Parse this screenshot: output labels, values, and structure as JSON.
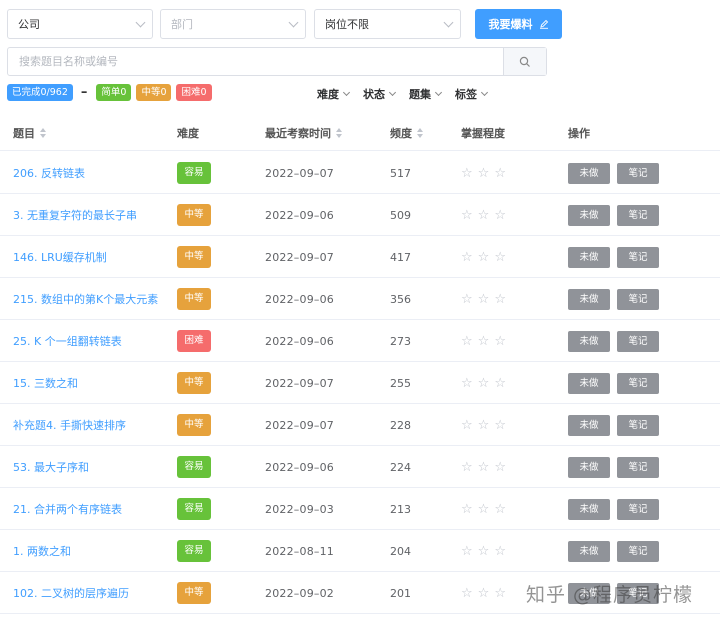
{
  "filters": {
    "company": "公司",
    "department": "部门",
    "position": "岗位不限",
    "submit_label": "我要爆料"
  },
  "search": {
    "placeholder": "搜索题目名称或编号"
  },
  "stats": {
    "completed": "已完成0/962",
    "easy": "简单0",
    "medium": "中等0",
    "hard": "困难0"
  },
  "dropdowns": [
    "难度",
    "状态",
    "题集",
    "标签"
  ],
  "columns": {
    "title": "题目",
    "difficulty": "难度",
    "last_time": "最近考察时间",
    "frequency": "频度",
    "mastery": "掌握程度",
    "actions": "操作"
  },
  "colors": {
    "easy": "#67c23a",
    "medium": "#e6a23c",
    "hard": "#f56c6c",
    "primary": "#409eff",
    "action": "#909399"
  },
  "rows": [
    {
      "title": "206. 反转链表",
      "difficulty": "容易",
      "level": "easy",
      "date": "2022–09–07",
      "freq": "517"
    },
    {
      "title": "3. 无重复字符的最长子串",
      "difficulty": "中等",
      "level": "medium",
      "date": "2022–09–06",
      "freq": "509"
    },
    {
      "title": "146. LRU缓存机制",
      "difficulty": "中等",
      "level": "medium",
      "date": "2022–09–07",
      "freq": "417"
    },
    {
      "title": "215. 数组中的第K个最大元素",
      "difficulty": "中等",
      "level": "medium",
      "date": "2022–09–06",
      "freq": "356"
    },
    {
      "title": "25. K 个一组翻转链表",
      "difficulty": "困难",
      "level": "hard",
      "date": "2022–09–06",
      "freq": "273"
    },
    {
      "title": "15. 三数之和",
      "difficulty": "中等",
      "level": "medium",
      "date": "2022–09–07",
      "freq": "255"
    },
    {
      "title": "补充题4. 手撕快速排序",
      "difficulty": "中等",
      "level": "medium",
      "date": "2022–09–07",
      "freq": "228"
    },
    {
      "title": "53. 最大子序和",
      "difficulty": "容易",
      "level": "easy",
      "date": "2022–09–06",
      "freq": "224"
    },
    {
      "title": "21. 合并两个有序链表",
      "difficulty": "容易",
      "level": "easy",
      "date": "2022–09–03",
      "freq": "213"
    },
    {
      "title": "1. 两数之和",
      "difficulty": "容易",
      "level": "easy",
      "date": "2022–08–11",
      "freq": "204"
    },
    {
      "title": "102. 二叉树的层序遍历",
      "difficulty": "中等",
      "level": "medium",
      "date": "2022–09–02",
      "freq": "201"
    }
  ],
  "row_actions": {
    "todo": "未做",
    "note": "笔记"
  },
  "stars": "☆",
  "watermark": "知乎 @程序员柠檬"
}
